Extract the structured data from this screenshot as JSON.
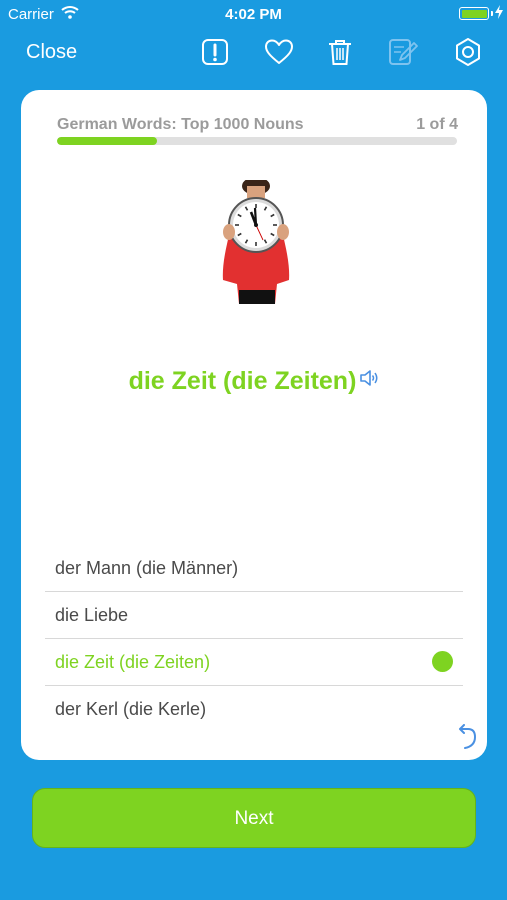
{
  "status_bar": {
    "carrier": "Carrier",
    "time": "4:02 PM"
  },
  "nav": {
    "close_label": "Close",
    "icons": [
      "report-icon",
      "heart-icon",
      "trash-icon",
      "edit-icon",
      "settings-icon"
    ]
  },
  "card": {
    "deck_title": "German Words: Top 1000 Nouns",
    "counter": "1 of 4",
    "progress": 0.25,
    "word": "die Zeit (die Zeiten)",
    "options": [
      {
        "label": "der Mann (die Männer)",
        "selected": false
      },
      {
        "label": "die Liebe",
        "selected": false
      },
      {
        "label": "die Zeit (die Zeiten)",
        "selected": true
      },
      {
        "label": "der Kerl (die Kerle)",
        "selected": false
      }
    ]
  },
  "next_label": "Next",
  "colors": {
    "background": "#1a9be0",
    "accent": "#7ed321",
    "text": "#4a4a4a",
    "muted": "#9b9b9b"
  }
}
